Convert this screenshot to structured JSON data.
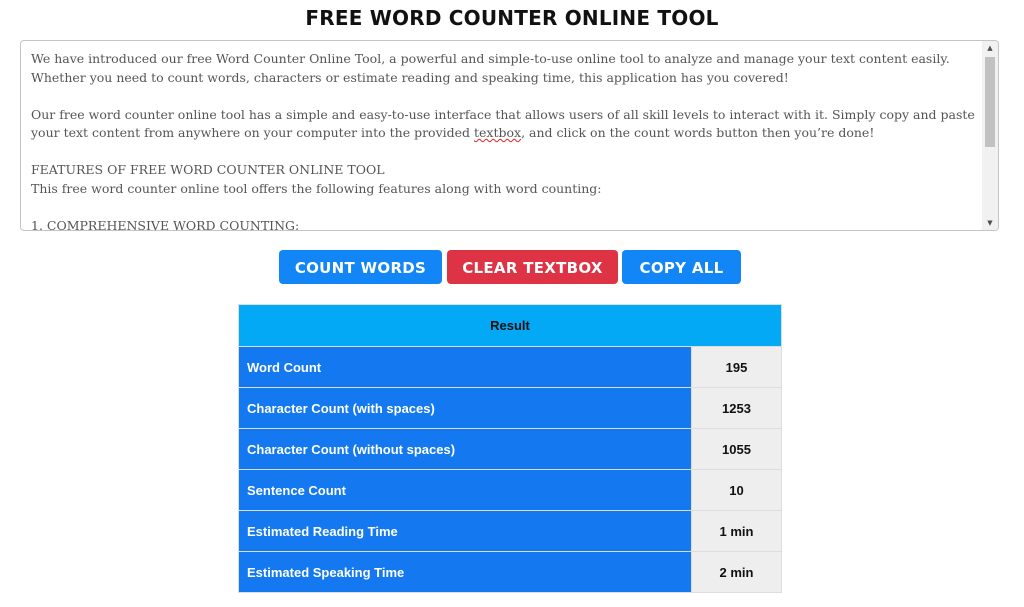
{
  "header": {
    "title": "FREE WORD COUNTER ONLINE TOOL"
  },
  "textbox": {
    "paragraphs": [
      "We have introduced our free Word Counter Online Tool, a powerful and simple-to-use online tool to analyze and manage your text content easily. Whether you need to count words, characters or estimate reading and speaking time, this application has you covered!",
      "Our free word counter online tool has a simple and easy-to-use interface that allows users of all skill levels to interact with it. Simply copy and paste your text content from anywhere on your computer into the provided ",
      "textbox",
      ", and click on the count words button then you’re done!",
      "FEATURES OF FREE WORD COUNTER ONLINE TOOL",
      "This free word counter online tool offers the following features along with word counting:",
      "1. COMPREHENSIVE WORD COUNTING:"
    ]
  },
  "buttons": {
    "count": "COUNT WORDS",
    "clear": "CLEAR TEXTBOX",
    "copy": "COPY ALL"
  },
  "colors": {
    "primary_button": "#1285f7",
    "danger_button": "#de3344",
    "result_header": "#03a9f4",
    "label_cell": "#1479f0",
    "value_cell": "#eeeeee"
  },
  "result": {
    "header": "Result",
    "rows": [
      {
        "label": "Word Count",
        "value": "195"
      },
      {
        "label": "Character Count (with spaces)",
        "value": "1253"
      },
      {
        "label": "Character Count (without spaces)",
        "value": "1055"
      },
      {
        "label": "Sentence Count",
        "value": "10"
      },
      {
        "label": "Estimated Reading Time",
        "value": "1 min"
      },
      {
        "label": "Estimated Speaking Time",
        "value": "2 min"
      }
    ]
  }
}
